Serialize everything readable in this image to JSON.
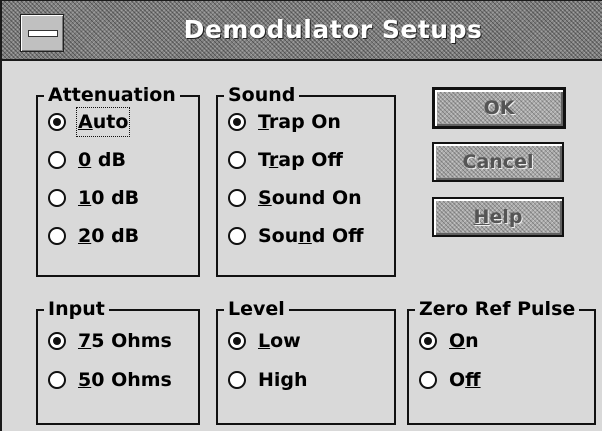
{
  "window": {
    "title": "Demodulator Setups"
  },
  "attenuation": {
    "label": "Attenuation",
    "options": [
      {
        "pre": "",
        "key": "A",
        "post": "uto",
        "checked": true,
        "focused": true
      },
      {
        "pre": "",
        "key": "0",
        "post": " dB",
        "checked": false
      },
      {
        "pre": "",
        "key": "1",
        "post": "0 dB",
        "checked": false
      },
      {
        "pre": "",
        "key": "2",
        "post": "0 dB",
        "checked": false
      }
    ]
  },
  "sound": {
    "label": "Sound",
    "options": [
      {
        "pre": "",
        "key": "T",
        "post": "rap On",
        "checked": true
      },
      {
        "pre": "T",
        "key": "r",
        "post": "ap Off",
        "checked": false
      },
      {
        "pre": "",
        "key": "S",
        "post": "ound On",
        "checked": false
      },
      {
        "pre": "Sou",
        "key": "n",
        "post": "d Off",
        "checked": false
      }
    ]
  },
  "input": {
    "label": "Input",
    "options": [
      {
        "pre": "",
        "key": "7",
        "post": "5 Ohms",
        "checked": true
      },
      {
        "pre": "",
        "key": "5",
        "post": "0 Ohms",
        "checked": false
      }
    ]
  },
  "level": {
    "label": "Level",
    "options": [
      {
        "pre": "",
        "key": "L",
        "post": "ow",
        "checked": true
      },
      {
        "pre": "Hi",
        "key": "g",
        "post": "h",
        "checked": false
      }
    ]
  },
  "zero_ref": {
    "label": "Zero Ref Pulse",
    "options": [
      {
        "pre": "",
        "key": "O",
        "post": "n",
        "checked": true
      },
      {
        "pre": "O",
        "key": "f",
        "post": "f",
        "checked": false
      }
    ]
  },
  "buttons": {
    "ok": {
      "pre": "",
      "key": "",
      "post": "OK"
    },
    "cancel": {
      "pre": "",
      "key": "",
      "post": "Cancel"
    },
    "help": {
      "pre": "",
      "key": "H",
      "post": "elp"
    }
  }
}
